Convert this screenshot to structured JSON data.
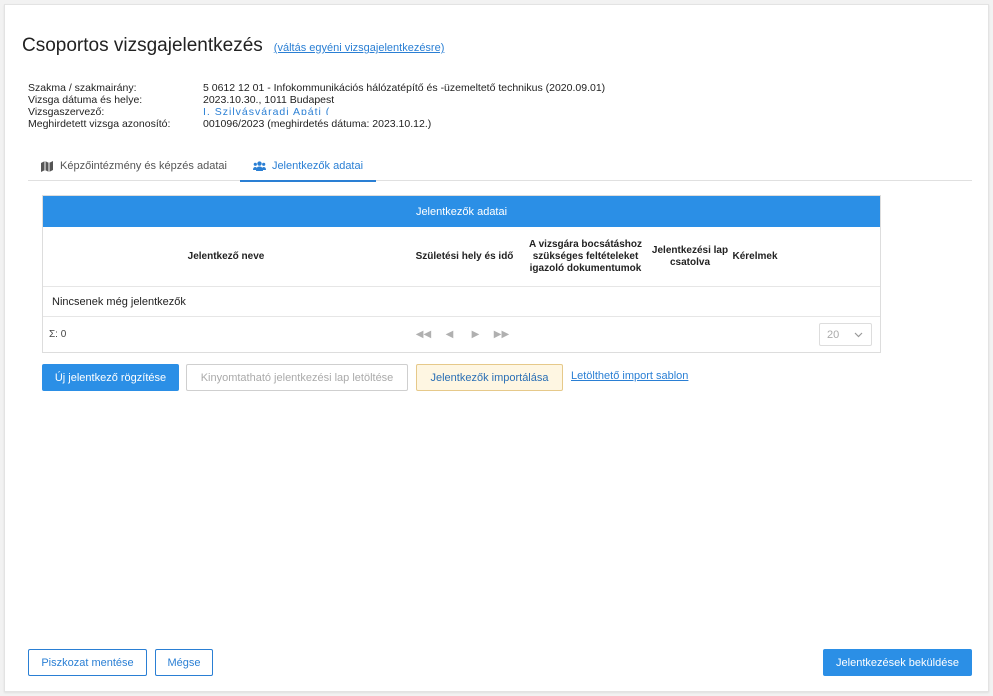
{
  "header": {
    "title": "Csoportos vizsgajelentkezés",
    "switch_link": "(váltás egyéni vizsgajelentkezésre)"
  },
  "info": [
    {
      "label": "Szakma / szakmairány:",
      "value": "5 0612 12 01 - Infokommunikációs hálózatépítő és -üzemeltető technikus (2020.09.01)"
    },
    {
      "label": "Vizsga dátuma és helye:",
      "value": "2023.10.30., 1011 Budapest"
    },
    {
      "label": "Vizsgaszervező:",
      "value": "I. Szilvásváradi Apáti ("
    },
    {
      "label": "Meghirdetett vizsga azonosító:",
      "value": "001096/2023 (meghirdetés dátuma: 2023.10.12.)"
    }
  ],
  "tabs": [
    {
      "label": "Képzőintézmény és képzés adatai",
      "icon": "map-icon"
    },
    {
      "label": "Jelentkezők adatai",
      "icon": "users-icon",
      "active": true
    }
  ],
  "grid": {
    "title": "Jelentkezők adatai",
    "columns": [
      "Jelentkező neve",
      "Születési hely és idő",
      "A vizsgára bocsátáshoz szükséges feltételeket igazoló dokumentumok",
      "Jelentkezési lap csatolva",
      "Kérelmek"
    ],
    "empty_text": "Nincsenek még jelentkezők",
    "sum_text": "Σ: 0",
    "page_size": "20"
  },
  "actions": {
    "new_applicant": "Új jelentkező rögzítése",
    "download_printable": "Kinyomtatható jelentkezési lap letöltése",
    "import": "Jelentkezők importálása",
    "template_link": "Letölthető import sablon"
  },
  "footer": {
    "save_draft": "Piszkozat mentése",
    "cancel": "Mégse",
    "submit": "Jelentkezések beküldése"
  },
  "colors": {
    "primary": "#2b8fe6",
    "link": "#2a7fd4",
    "warn_bg": "#fef6e2"
  }
}
